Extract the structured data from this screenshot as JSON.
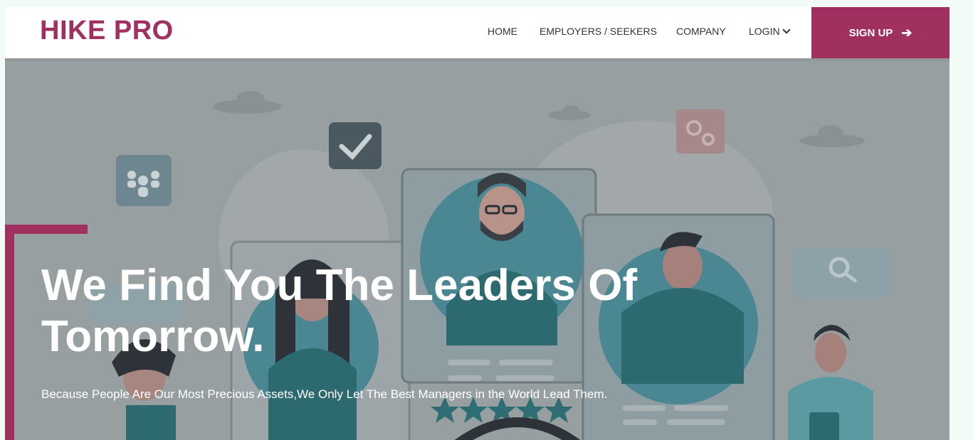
{
  "brand": {
    "logo": "HIKE PRO",
    "accent_color": "#a0305f"
  },
  "nav": {
    "items": [
      {
        "label": "HOME"
      },
      {
        "label": "EMPLOYERS / SEEKERS"
      },
      {
        "label": "COMPANY"
      },
      {
        "label": "LOGIN",
        "icon": "chevron-down-icon"
      }
    ],
    "signup": {
      "label": "SIGN UP",
      "icon": "arrow-right-icon"
    }
  },
  "hero": {
    "headline": "We Find You The Leaders Of Tomorrow.",
    "subtext": "Because People Are Our Most Precious Assets,We Only Let The Best Managers in the World Lead Them.",
    "illustration_icons": [
      "team-icon",
      "checkmark-icon",
      "gears-icon",
      "search-icon",
      "cloud-icon"
    ]
  }
}
